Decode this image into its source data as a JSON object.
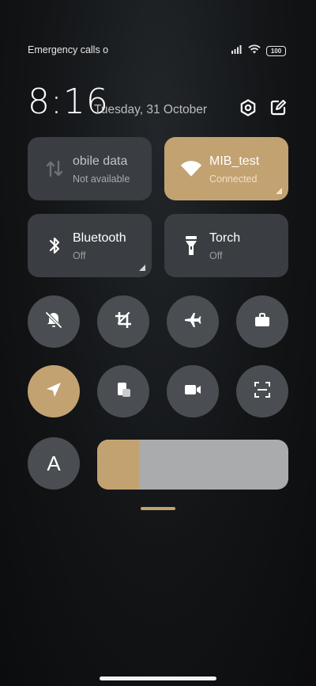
{
  "status": {
    "carrier_text": "Emergency calls o",
    "battery": "100"
  },
  "header": {
    "time": "8:16",
    "date": "Tuesday, 31 October"
  },
  "tiles": [
    {
      "label": "obile data",
      "sub": "Not available"
    },
    {
      "label": "MIB_test",
      "sub": "Connected"
    },
    {
      "label": "Bluetooth",
      "sub": "Off"
    },
    {
      "label": "Torch",
      "sub": "Off"
    }
  ],
  "font_button": {
    "label": "A"
  },
  "brightness": {
    "level": 0.22
  },
  "colors": {
    "accent": "#c3a271",
    "tile": "#3a3e42",
    "round": "#4a4e52"
  }
}
